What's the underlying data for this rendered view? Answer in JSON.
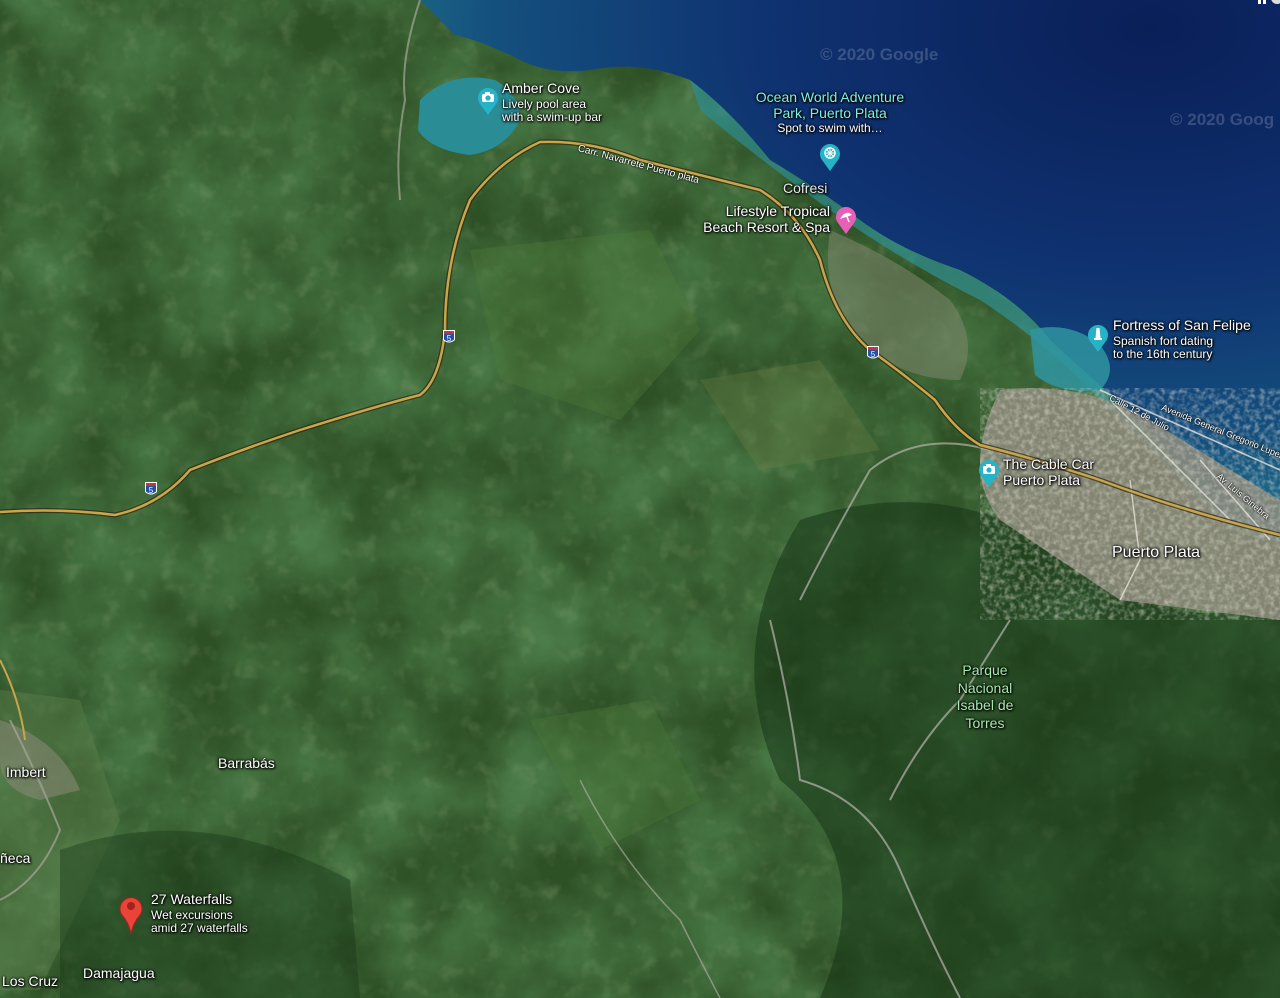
{
  "watermarks": [
    "© 2020 Google",
    "© 2020 Goog"
  ],
  "pois": [
    {
      "title": "Amber Cove",
      "subtitle": "Lively pool area\nwith a swim-up bar",
      "icon": "camera-icon",
      "color": "#26b3c8"
    },
    {
      "title": "Ocean World Adventure\nPark, Puerto Plata",
      "subtitle": "Spot to swim with…",
      "icon": "amusement-park-icon",
      "color": "#26b3c8"
    },
    {
      "title": "Lifestyle Tropical\nBeach Resort & Spa",
      "subtitle": "",
      "icon": "resort-icon",
      "color": "#e85fb8"
    },
    {
      "title": "Fortress of San Felipe",
      "subtitle": "Spanish fort dating\nto the 16th century",
      "icon": "monument-icon",
      "color": "#26b3c8"
    },
    {
      "title": "The Cable Car\nPuerto Plata",
      "subtitle": "",
      "icon": "camera-icon",
      "color": "#26b3c8"
    },
    {
      "title": "27 Waterfalls",
      "subtitle": "Wet excursions\namid 27 waterfalls",
      "icon": "map-pin-icon",
      "color": "#e8443a"
    }
  ],
  "places": {
    "cofresi": "Cofresi",
    "puerto_plata": "Puerto Plata",
    "park": "Parque\nNacional\nIsabel de\nTorres",
    "imbert": "Imbert",
    "barrabas": "Barrabás",
    "laguneca": "ñeca",
    "damajagua": "Damajagua",
    "los_cruz": "Los Cruz"
  },
  "roads": {
    "highway_number": "5",
    "carretera": "Carr. Navarrete Puerto plata",
    "calle": "Calle 12 de Julio",
    "avenida": "Avenida General Gregorio Luperón",
    "luis_ginebra": "Av. Luis Ginebra"
  },
  "colors": {
    "ocean": "#0e2f6a",
    "land": "#2f5226",
    "poi_teal": "#26b3c8",
    "poi_pink": "#e85fb8",
    "pin_red": "#e8443a",
    "highway": "#c9a64a"
  }
}
